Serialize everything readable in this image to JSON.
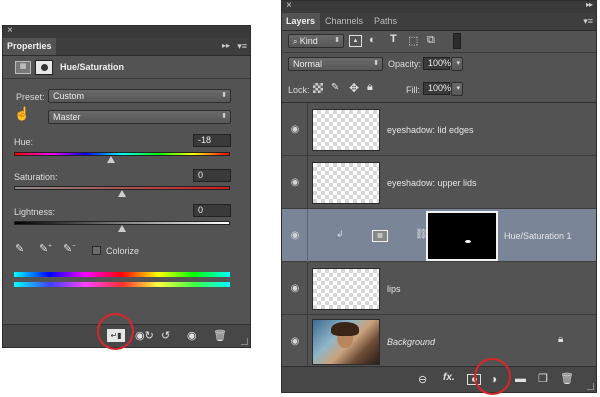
{
  "properties": {
    "tab": "Properties",
    "title": "Hue/Saturation",
    "preset_label": "Preset:",
    "preset_value": "Custom",
    "channel_value": "Master",
    "hue_label": "Hue:",
    "hue_value": "-18",
    "hue_level": 0.45,
    "saturation_label": "Saturation:",
    "saturation_value": "0",
    "saturation_level": 0.5,
    "lightness_label": "Lightness:",
    "lightness_value": "0",
    "lightness_level": 0.5,
    "colorize_label": "Colorize"
  },
  "layers_panel": {
    "tabs": [
      "Layers",
      "Channels",
      "Paths"
    ],
    "kind_label": "Kind",
    "blend_mode": "Normal",
    "opacity_label": "Opacity:",
    "opacity_value": "100%",
    "lock_label": "Lock:",
    "fill_label": "Fill:",
    "fill_value": "100%",
    "fx_label": "fx.",
    "layers": [
      {
        "name": "eyeshadow: lid edges"
      },
      {
        "name": "eyeshadow: upper lids"
      },
      {
        "name": "Hue/Saturation 1"
      },
      {
        "name": "lips"
      },
      {
        "name": "Background"
      }
    ]
  },
  "colors": {
    "panel_bg": "#535353",
    "selected_layer": "#7b8598",
    "highlight_circle": "#d8262b"
  }
}
